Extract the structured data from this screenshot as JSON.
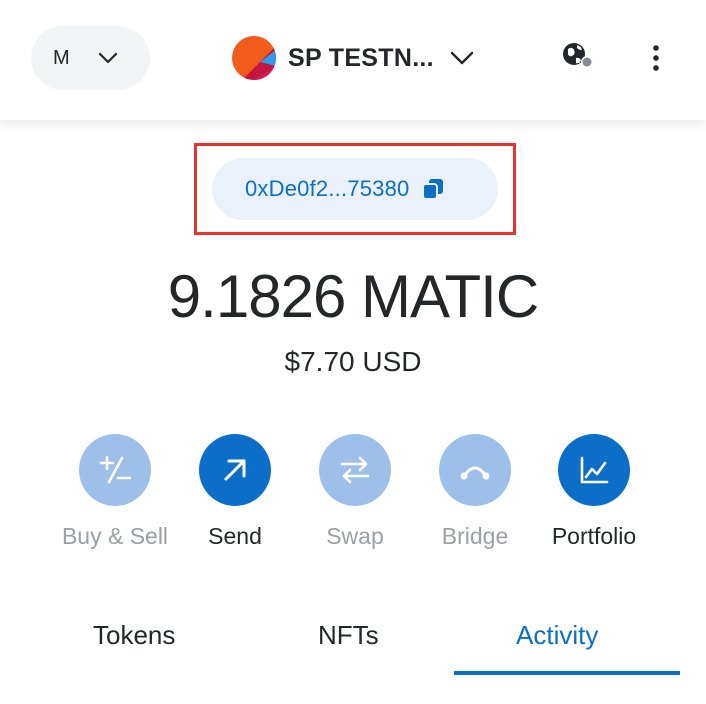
{
  "header": {
    "account_initial": "M",
    "network_name": "SP TESTN...",
    "icons": {
      "account_chevron": "chevron-down-icon",
      "network_chevron": "chevron-down-icon",
      "globe": "globe-connected-icon",
      "menu": "kebab-menu-icon"
    }
  },
  "address": {
    "display": "0xDe0f2...75380",
    "copy_icon": "copy-icon"
  },
  "balance": {
    "amount": "9.1826 MATIC",
    "fiat": "$7.70 USD"
  },
  "actions": [
    {
      "label": "Buy & Sell",
      "icon": "buy-sell-icon",
      "state": "disabled"
    },
    {
      "label": "Send",
      "icon": "send-arrow-icon",
      "state": "active"
    },
    {
      "label": "Swap",
      "icon": "swap-arrows-icon",
      "state": "disabled"
    },
    {
      "label": "Bridge",
      "icon": "bridge-icon",
      "state": "disabled"
    },
    {
      "label": "Portfolio",
      "icon": "portfolio-chart-icon",
      "state": "active"
    }
  ],
  "tabs": [
    {
      "label": "Tokens",
      "active": false
    },
    {
      "label": "NFTs",
      "active": false
    },
    {
      "label": "Activity",
      "active": true
    }
  ],
  "colors": {
    "accent": "#0b6fca",
    "accent_disabled": "#9cc0ea",
    "highlight_border": "#e8332b",
    "address_bg": "#eaf1fb",
    "text": "#24272a",
    "muted_text": "#9aa0a6"
  }
}
